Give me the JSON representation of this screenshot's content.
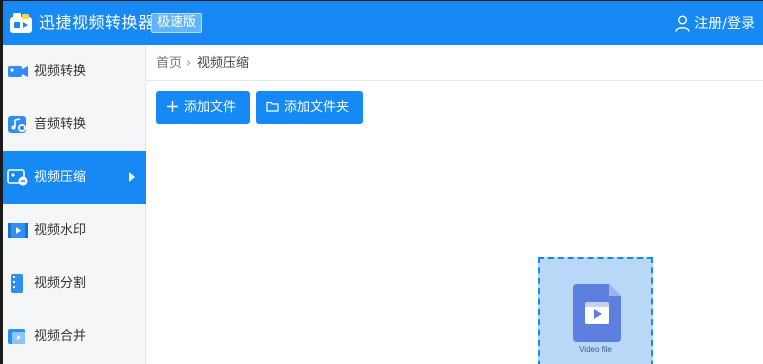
{
  "titlebar": {
    "app_name": "迅捷视频转换器",
    "edition_badge": "极速版",
    "login_label": "注册/登录",
    "bg_color": "#1689f5"
  },
  "sidebar": {
    "items": [
      {
        "label": "视频转换",
        "icon": "video-convert-icon",
        "active": false
      },
      {
        "label": "音频转换",
        "icon": "audio-convert-icon",
        "active": false
      },
      {
        "label": "视频压缩",
        "icon": "video-compress-icon",
        "active": true
      },
      {
        "label": "视频水印",
        "icon": "video-watermark-icon",
        "active": false
      },
      {
        "label": "视频分割",
        "icon": "video-split-icon",
        "active": false
      },
      {
        "label": "视频合并",
        "icon": "video-merge-icon",
        "active": false
      }
    ]
  },
  "breadcrumb": {
    "home": "首页",
    "separator": "›",
    "current": "视频压缩"
  },
  "toolbar": {
    "add_file_label": "添加文件",
    "add_folder_label": "添加文件夹"
  },
  "drop_zone": {
    "caption": "Video file",
    "icon": "video-file-icon"
  }
}
